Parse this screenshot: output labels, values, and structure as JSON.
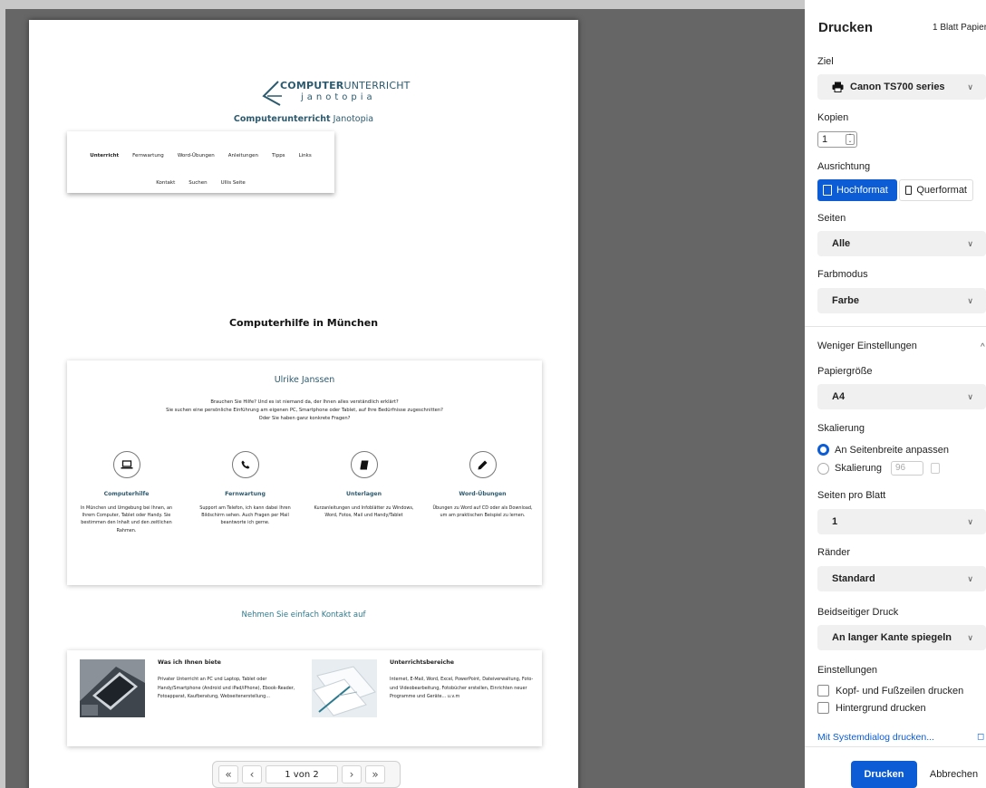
{
  "preview": {
    "logo": {
      "main_bold": "COMPUTER",
      "main_rest": "UNTERRICHT",
      "sub": "janotopia"
    },
    "site_title": {
      "bold": "Computerunterricht",
      "rest": " Janotopia"
    },
    "nav": {
      "row1": [
        "Unterricht",
        "Fernwartung",
        "Word-Übungen",
        "Anleitungen",
        "Tipps",
        "Links"
      ],
      "row2": [
        "Kontakt",
        "Suchen",
        "Ullis Seite"
      ]
    },
    "heading": "Computerhilfe in München",
    "intro": {
      "name": "Ulrike Janssen",
      "line1": "Brauchen Sie Hilfe? Und es ist niemand da, der Ihnen alles verständlich erklärt?",
      "line2": "Sie suchen eine persönliche Einführung am eigenen PC, Smartphone oder Tablet, auf Ihre Bedürfnisse zugeschnitten?",
      "line3": "Oder Sie haben ganz konkrete Fragen?"
    },
    "features": [
      {
        "icon": "laptop-icon",
        "title": "Computerhilfe",
        "text": "In München und Umgebung bei Ihnen, an Ihrem Computer, Tablet oder Handy. Sie bestimmen den Inhalt und den zeitlichen Rahmen."
      },
      {
        "icon": "phone-icon",
        "title": "Fernwartung",
        "text": "Support am Telefon, ich kann dabei Ihren Bildschirm sehen. Auch Fragen per Mail beantworte ich gerne."
      },
      {
        "icon": "book-icon",
        "title": "Unterlagen",
        "text": "Kurzanleitungen und Infoblätter zu Windows, Word, Fotos, Mail und Handy/Tablet"
      },
      {
        "icon": "pencil-icon",
        "title": "Word-Übungen",
        "text": "Übungen zu Word auf CD oder als Download, um am praktischen Beispiel zu lernen."
      }
    ],
    "contact": "Nehmen Sie einfach Kontakt auf",
    "offers": [
      {
        "title": "Was ich Ihnen biete",
        "text": "Privater Unterricht an PC und Laptop, Tablet oder Handy/Smartphone (Android und iPad/iPhone), Ebook-Reader, Fotoapparat, Kaufberatung, Webseitenerstellung..."
      },
      {
        "title": "Unterrichtsbereiche",
        "text": "Internet, E-Mail, Word, Excel, PowerPoint, Dateiverwaltung, Foto- und Videobearbeitung, Fotobücher erstellen, Einrichten neuer Programme und Geräte... u.v.m"
      }
    ],
    "pager": {
      "first": "«",
      "prev": "‹",
      "label": "1 von 2",
      "next": "›",
      "last": "»"
    }
  },
  "panel": {
    "title": "Drucken",
    "sheet_count": "1 Blatt Papier",
    "destination_label": "Ziel",
    "destination": "Canon TS700 series",
    "copies_label": "Kopien",
    "copies": "1",
    "orientation_label": "Ausrichtung",
    "portrait": "Hochformat",
    "landscape": "Querformat",
    "pages_label": "Seiten",
    "pages": "Alle",
    "color_label": "Farbmodus",
    "color": "Farbe",
    "less_settings": "Weniger Einstellungen",
    "paper_label": "Papiergröße",
    "paper": "A4",
    "scale_label": "Skalierung",
    "scale_fit": "An Seitenbreite anpassen",
    "scale_custom": "Skalierung",
    "scale_value": "96",
    "pps_label": "Seiten pro Blatt",
    "pps": "1",
    "margins_label": "Ränder",
    "margins": "Standard",
    "duplex_label": "Beidseitiger Druck",
    "duplex": "An langer Kante spiegeln",
    "settings_label": "Einstellungen",
    "opt_headers": "Kopf- und Fußzeilen drucken",
    "opt_background": "Hintergrund drucken",
    "system_dialog": "Mit Systemdialog drucken...",
    "print_btn": "Drucken",
    "cancel_btn": "Abbrechen",
    "accent": "#0b5cd5"
  }
}
